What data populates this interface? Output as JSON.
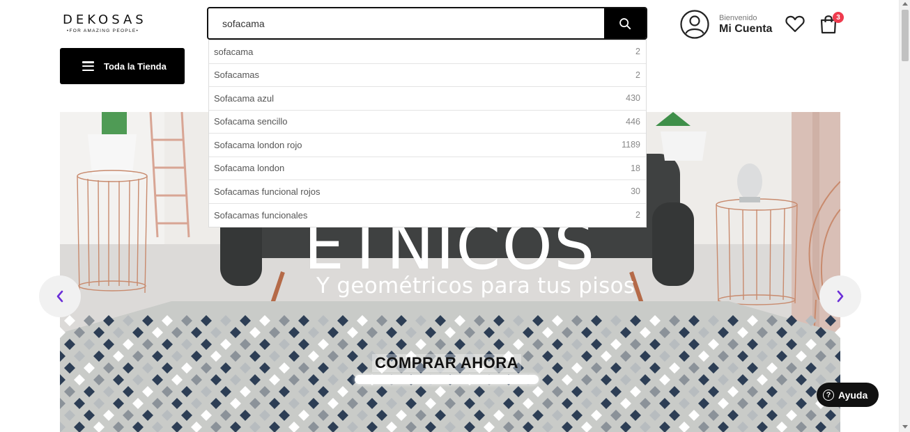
{
  "logo": {
    "name": "DEKOSAS",
    "tagline": "•FOR AMAZING PEOPLE•"
  },
  "search": {
    "value": "sofacama",
    "placeholder": "",
    "suggestions": [
      {
        "label": "sofacama",
        "count": "2"
      },
      {
        "label": "Sofacamas",
        "count": "2"
      },
      {
        "label": "Sofacama azul",
        "count": "430"
      },
      {
        "label": "Sofacama sencillo",
        "count": "446"
      },
      {
        "label": "Sofacama london rojo",
        "count": "1189"
      },
      {
        "label": "Sofacama london",
        "count": "18"
      },
      {
        "label": "Sofacamas funcional rojos",
        "count": "30"
      },
      {
        "label": "Sofacamas funcionales",
        "count": "2"
      }
    ]
  },
  "account": {
    "greeting": "Bienvenido",
    "label": "Mi Cuenta"
  },
  "cart": {
    "count": "3"
  },
  "nav": {
    "all_store_label": "Toda la Tienda"
  },
  "hero": {
    "title": "ETNICOS",
    "subtitle": "Y geométricos para tus pisos",
    "cta_label": "COMPRAR AHORA"
  },
  "help": {
    "label": "Ayuda"
  },
  "icons": {
    "search": "search-icon",
    "account": "user-circle-icon",
    "wishlist": "heart-icon",
    "cart": "shopping-bag-icon",
    "menu": "hamburger-icon",
    "prev": "chevron-left-icon",
    "next": "chevron-right-icon",
    "help": "question-circle-icon"
  },
  "colors": {
    "primary": "#000000",
    "badge": "#ef3b4e",
    "arrow": "#6b2fd8"
  }
}
